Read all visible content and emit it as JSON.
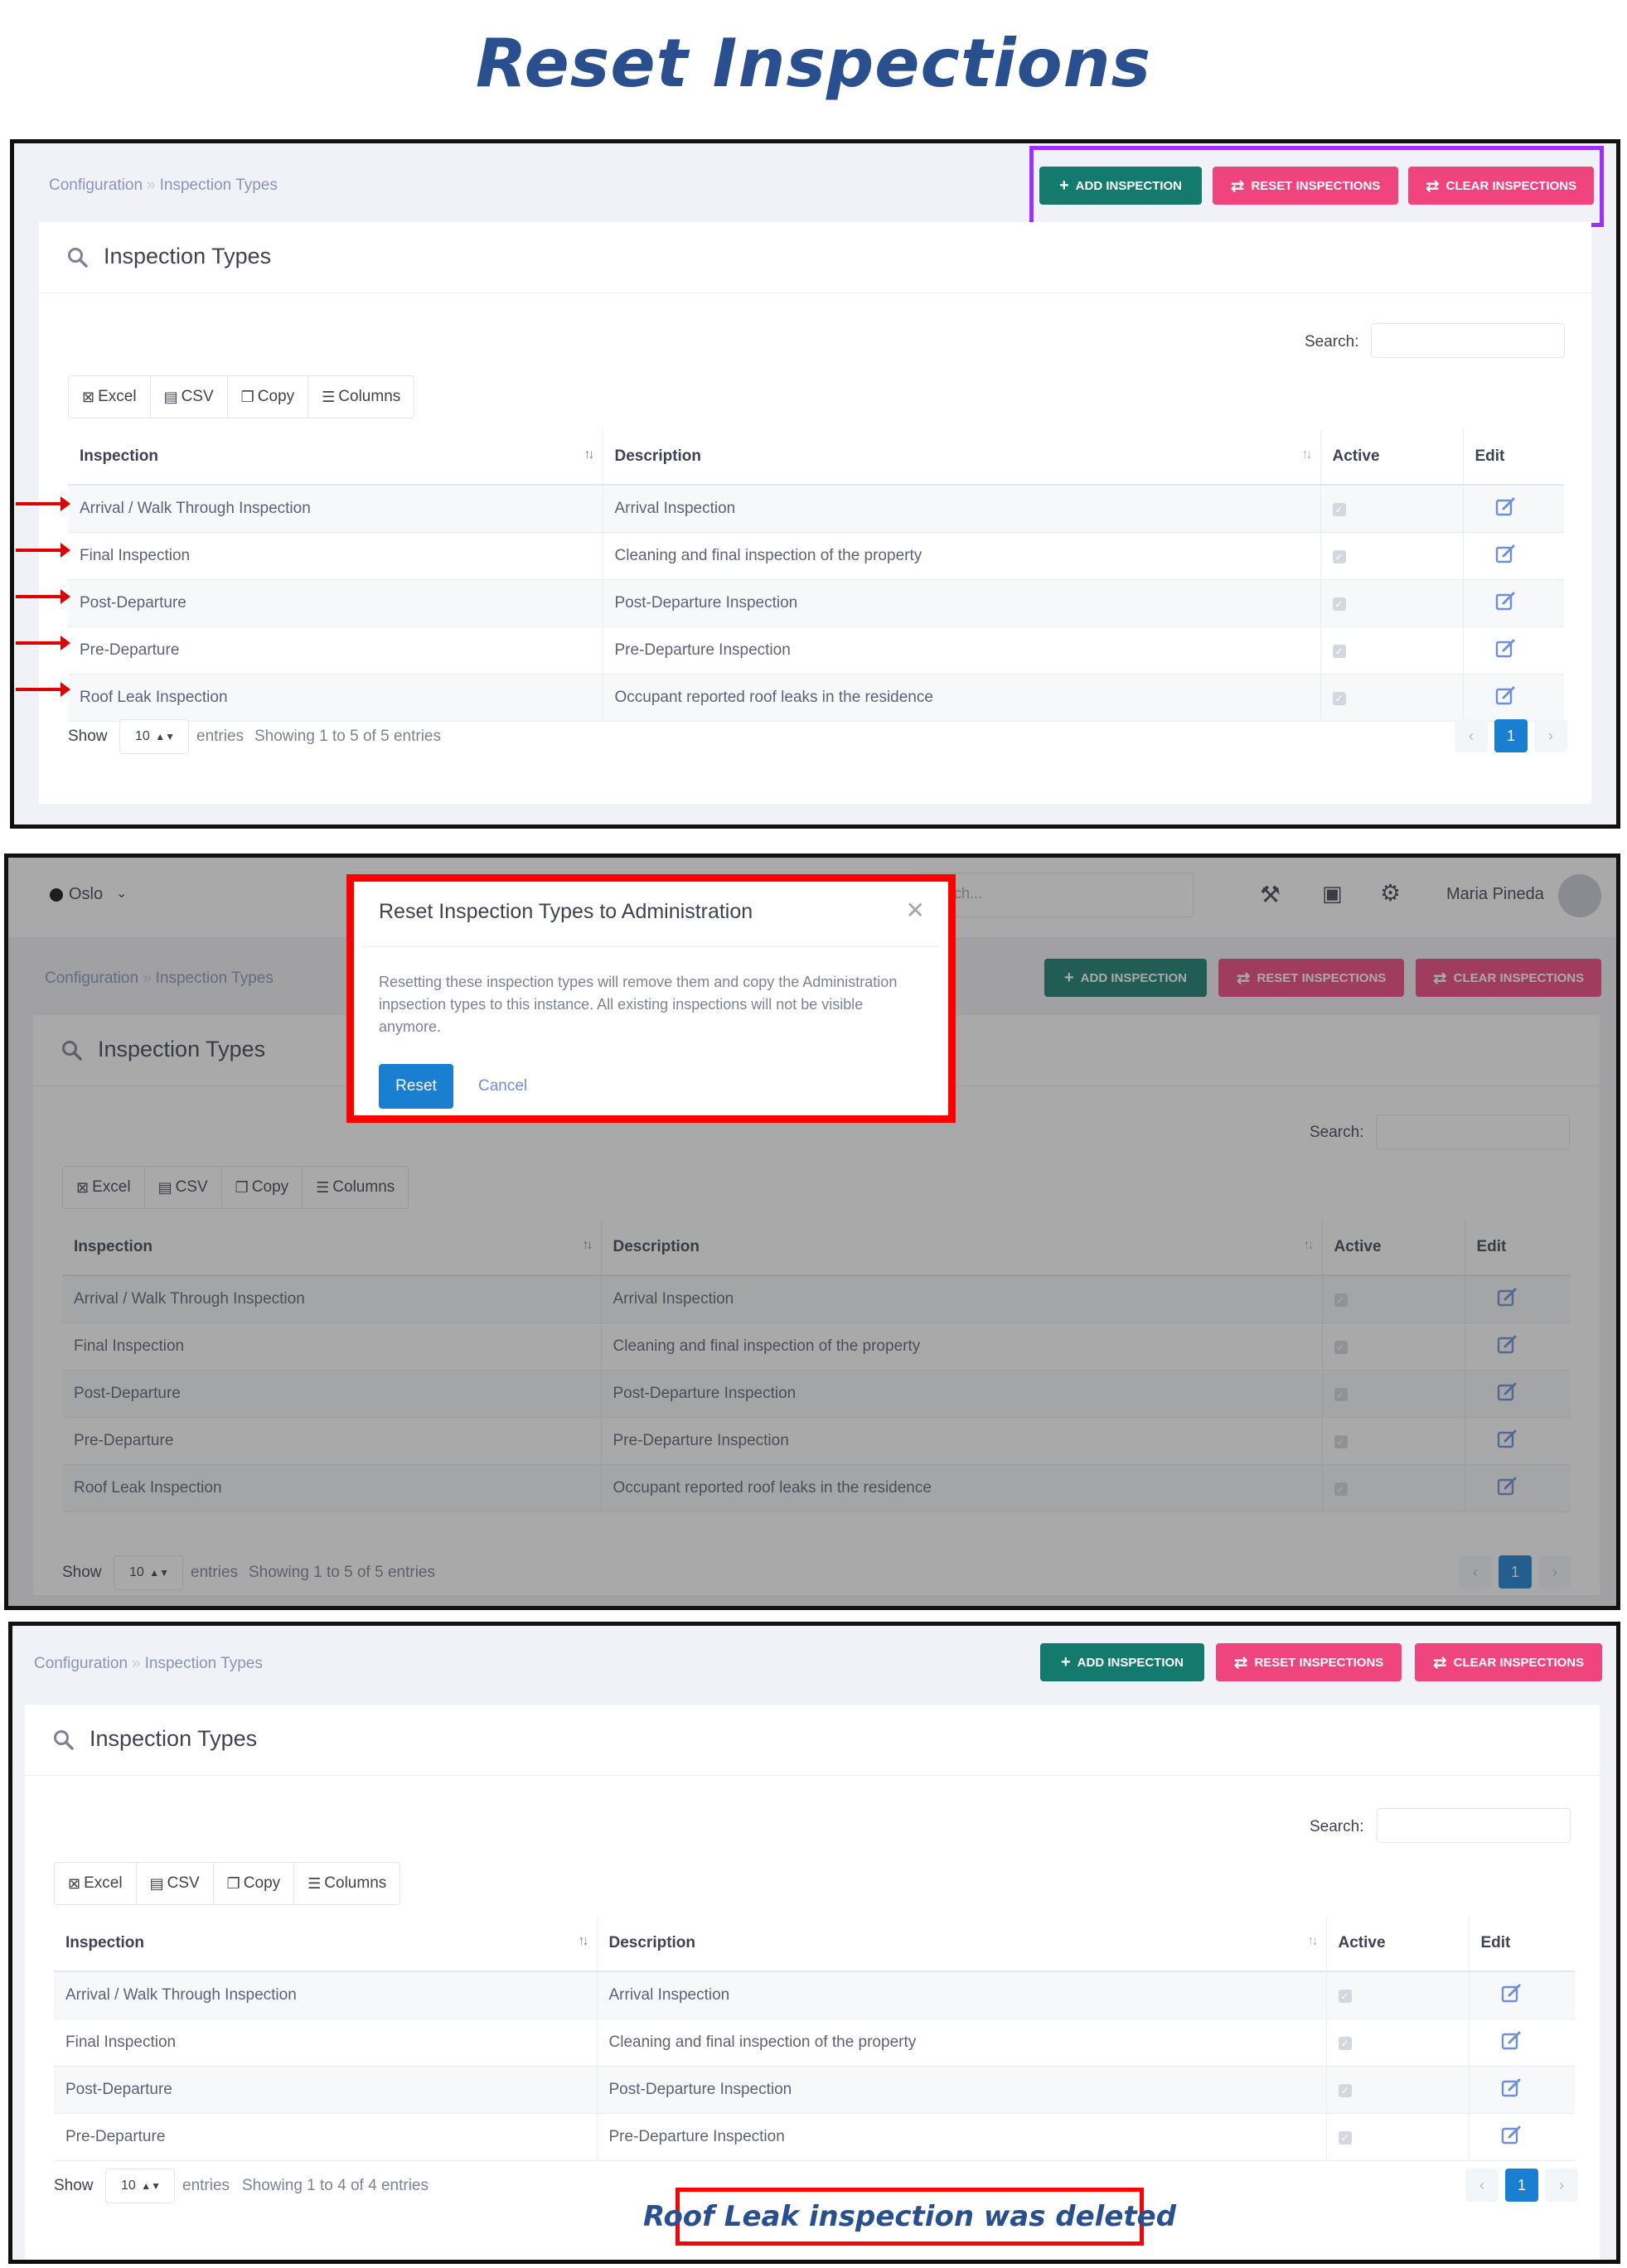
{
  "page_title": "Reset Inspections",
  "breadcrumb": {
    "parent": "Configuration",
    "sep": "»",
    "current": "Inspection Types"
  },
  "buttons": {
    "add": "ADD INSPECTION",
    "reset": "RESET INSPECTIONS",
    "clear": "CLEAR INSPECTIONS"
  },
  "card_title": "Inspection Types",
  "search_label": "Search:",
  "export_buttons": [
    "Excel",
    "CSV",
    "Copy",
    "Columns"
  ],
  "table_headers": {
    "inspection": "Inspection",
    "description": "Description",
    "active": "Active",
    "edit": "Edit"
  },
  "rows_before": [
    {
      "inspection": "Arrival / Walk Through Inspection",
      "description": "Arrival Inspection",
      "active": true
    },
    {
      "inspection": "Final Inspection",
      "description": "Cleaning and final inspection of the property",
      "active": true
    },
    {
      "inspection": "Post-Departure",
      "description": "Post-Departure Inspection",
      "active": true
    },
    {
      "inspection": "Pre-Departure",
      "description": "Pre-Departure Inspection",
      "active": true
    },
    {
      "inspection": "Roof Leak Inspection",
      "description": "Occupant reported roof leaks in the residence",
      "active": true
    }
  ],
  "rows_after": [
    {
      "inspection": "Arrival / Walk Through Inspection",
      "description": "Arrival Inspection",
      "active": true
    },
    {
      "inspection": "Final Inspection",
      "description": "Cleaning and final inspection of the property",
      "active": true
    },
    {
      "inspection": "Post-Departure",
      "description": "Post-Departure Inspection",
      "active": true
    },
    {
      "inspection": "Pre-Departure",
      "description": "Pre-Departure Inspection",
      "active": true
    }
  ],
  "footer": {
    "show": "Show",
    "page_length": "10",
    "entries": "entries",
    "info_before": "Showing 1 to 5 of 5 entries",
    "info_after": "Showing 1 to 4 of 4 entries",
    "current_page": "1"
  },
  "topbar": {
    "location": "Oslo",
    "search_partial": "ch...",
    "user_name": "Maria Pineda"
  },
  "modal": {
    "title": "Reset Inspection Types to Administration",
    "body": "Resetting these inspection types will remove them and copy the Administration inpsection types to this instance. All existing inspections will not be visible anymore.",
    "reset_label": "Reset",
    "cancel_label": "Cancel"
  },
  "note": "Roof Leak inspection was deleted",
  "colors": {
    "title_blue": "#2a4f8e",
    "add_green": "#157a6e",
    "pink": "#f0447f",
    "primary_blue": "#1a7fd0",
    "highlight_purple": "#9b30ff",
    "annotation_red": "#ff0000"
  }
}
